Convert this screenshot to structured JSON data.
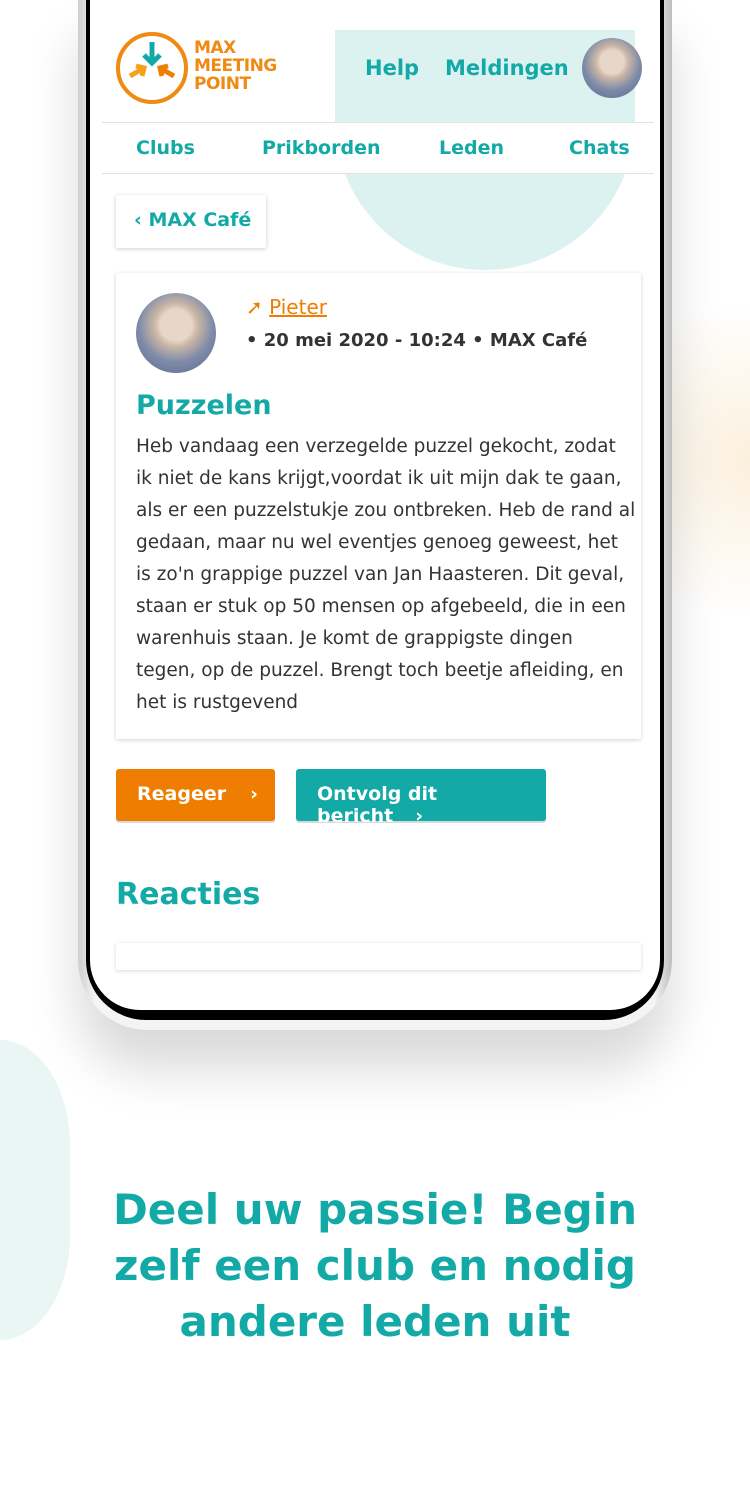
{
  "logo": {
    "line1": "MAX",
    "line2": "MEETING",
    "line3": "POINT"
  },
  "header": {
    "help": "Help",
    "notifications": "Meldingen"
  },
  "tabs": [
    "Clubs",
    "Prikborden",
    "Leden",
    "Chats"
  ],
  "back_button": "MAX Café",
  "post": {
    "author": "Pieter",
    "meta": "• 20 mei 2020 - 10:24 • MAX Café",
    "title": "Puzzelen",
    "body": "Heb vandaag een verzegelde puzzel gekocht, zodat ik niet de kans krijgt,voordat ik uit mijn dak te gaan, als er een puzzelstukje zou ontbreken. Heb de rand al gedaan, maar nu wel eventjes genoeg geweest, het is zo'n grappige puzzel van Jan Haasteren. Dit geval, staan er stuk op 50 mensen op afgebeeld, die in een warenhuis staan. Je komt de grappigste dingen tegen, op de puzzel. Brengt toch beetje afleiding, en het is rustgevend"
  },
  "actions": {
    "reply": "Reageer",
    "unfollow": "Ontvolg dit bericht"
  },
  "reactions_title": "Reacties",
  "tagline": "Deel uw passie! Begin zelf een club en nodig andere leden uit",
  "colors": {
    "teal": "#12a9a6",
    "orange": "#ef7d00"
  }
}
